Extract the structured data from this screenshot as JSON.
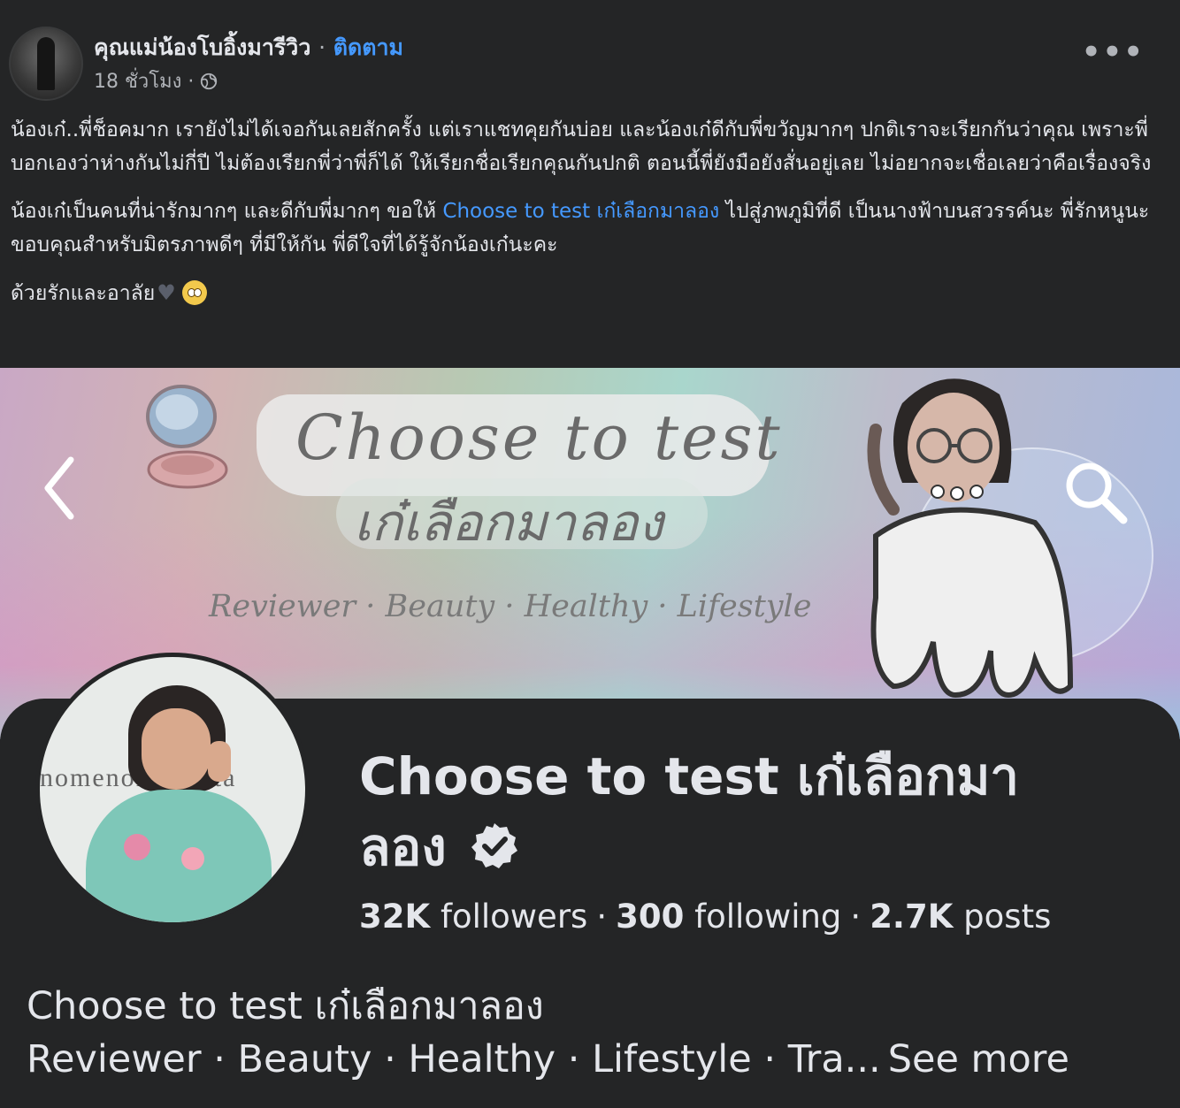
{
  "post": {
    "author": "คุณแม่น้องโบอิ้งมารีวิว",
    "separator": "·",
    "follow": "ติดตาม",
    "time": "18 ชั่วโมง ·",
    "paragraphs": {
      "p1": "น้องเก๋..พี่ช็อคมาก เรายังไม่ได้เจอกันเลยสักครั้ง แต่เราแชทคุยกันบ่อย และน้องเก๋ดีกับพี่ขวัญมากๆ ปกติเราจะเรียกกันว่าคุณ เพราะพี่บอกเองว่าห่างกันไม่กี่ปี ไม่ต้องเรียกพี่ว่าพี่ก็ได้ ให้เรียกชื่อเรียกคุณกันปกติ ตอนนี้พี่ยังมือยังสั่นอยู่เลย ไม่อยากจะเชื่อเลยว่าคือเรื่องจริง",
      "p2_before": "น้องเก๋เป็นคนที่น่ารักมากๆ และดีกับพี่มากๆ ขอให้ ",
      "p2_link": "Choose to test เก๋เลือกมาลอง",
      "p2_after": " ไปสู่ภพภูมิที่ดี เป็นนางฟ้าบนสวรรค์นะ พี่รักหนูนะ ขอบคุณสำหรับมิตรภาพดีๆ ที่มีให้กัน พี่ดีใจที่ได้รู้จักน้องเก๋นะคะ",
      "p3": "ด้วยรักและอาลัย"
    },
    "icons": [
      "globe-icon",
      "more-icon",
      "black-heart-icon",
      "flushed-face-emoji"
    ]
  },
  "cover": {
    "title": "Choose to test",
    "thai_title": "เก๋เลือกมาลอง",
    "tagline": "Reviewer · Beauty · Healthy · Lifestyle",
    "icons": [
      "back-arrow-icon",
      "search-icon"
    ]
  },
  "profile": {
    "name": "Choose to test เก๋เลือกมาลอง",
    "avatar_bg_text": "nomenon   lifesta",
    "followers_count": "32K",
    "followers_label": "followers",
    "following_count": "300",
    "following_label": "following",
    "posts_count": "2.7K",
    "posts_label": "posts",
    "dot": "·",
    "bio_line1": "Choose to test เก๋เลือกมาลอง",
    "bio_line2": "Reviewer · Beauty · Healthy · Lifestyle · Tra...",
    "see_more": "See more",
    "icons": [
      "verified-badge-icon"
    ]
  },
  "colors": {
    "background": "#242526",
    "text": "#e4e6eb",
    "muted": "#b0b3b8",
    "link": "#4599ff"
  }
}
